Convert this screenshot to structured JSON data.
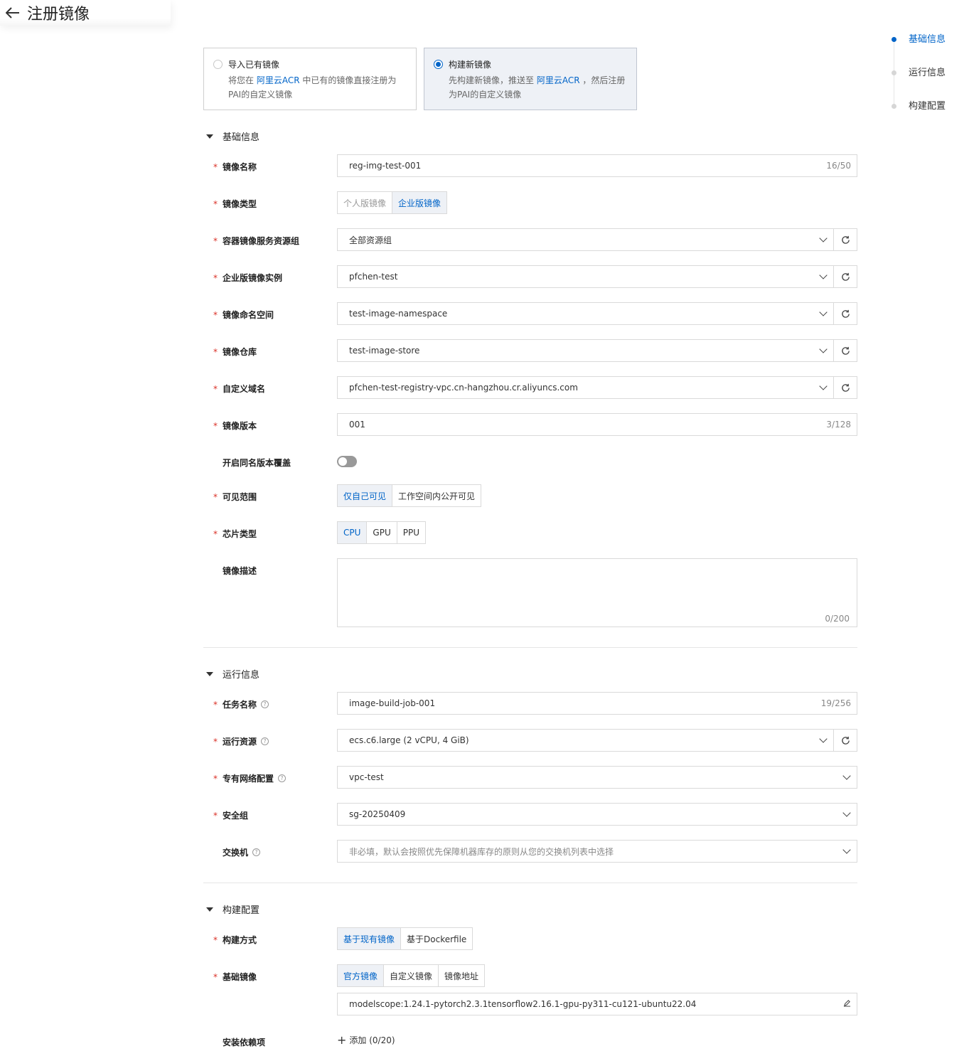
{
  "header": {
    "title": "注册镜像"
  },
  "anchor": [
    "基础信息",
    "运行信息",
    "构建配置"
  ],
  "cards": [
    {
      "title": "导入已有镜像",
      "desc_pre": "将您在 ",
      "desc_link": "阿里云ACR",
      "desc_post": " 中已有的镜像直接注册为PAI的自定义镜像"
    },
    {
      "title": "构建新镜像",
      "desc_pre": "先构建新镜像，推送至 ",
      "desc_link": "阿里云ACR",
      "desc_post": " ，然后注册为PAI的自定义镜像"
    }
  ],
  "basic": {
    "section": "基础信息",
    "name": {
      "label": "镜像名称",
      "value": "reg-img-test-001",
      "count": "16/50"
    },
    "type": {
      "label": "镜像类型",
      "options": [
        "个人版镜像",
        "企业版镜像"
      ]
    },
    "group": {
      "label": "容器镜像服务资源组",
      "value": "全部资源组"
    },
    "instance": {
      "label": "企业版镜像实例",
      "value": "pfchen-test"
    },
    "namespace": {
      "label": "镜像命名空间",
      "value": "test-image-namespace"
    },
    "repo": {
      "label": "镜像仓库",
      "value": "test-image-store"
    },
    "domain": {
      "label": "自定义域名",
      "value": "pfchen-test-registry-vpc.cn-hangzhou.cr.aliyuncs.com"
    },
    "version": {
      "label": "镜像版本",
      "value": "001",
      "count": "3/128"
    },
    "overwrite": {
      "label": "开启同名版本覆盖"
    },
    "visibility": {
      "label": "可见范围",
      "options": [
        "仅自己可见",
        "工作空间内公开可见"
      ]
    },
    "chip": {
      "label": "芯片类型",
      "options": [
        "CPU",
        "GPU",
        "PPU"
      ]
    },
    "desc": {
      "label": "镜像描述",
      "count": "0/200"
    }
  },
  "run": {
    "section": "运行信息",
    "job": {
      "label": "任务名称",
      "value": "image-build-job-001",
      "count": "19/256"
    },
    "resource": {
      "label": "运行资源",
      "value": "ecs.c6.large (2 vCPU, 4 GiB)"
    },
    "vpc": {
      "label": "专有网络配置",
      "value": "vpc-test"
    },
    "sg": {
      "label": "安全组",
      "value": "sg-20250409"
    },
    "vswitch": {
      "label": "交换机",
      "placeholder": "非必填，默认会按照优先保障机器库存的原则从您的交换机列表中选择"
    }
  },
  "build": {
    "section": "构建配置",
    "method": {
      "label": "构建方式",
      "options": [
        "基于现有镜像",
        "基于Dockerfile"
      ]
    },
    "base": {
      "label": "基础镜像",
      "options": [
        "官方镜像",
        "自定义镜像",
        "镜像地址"
      ],
      "value": "modelscope:1.24.1-pytorch2.3.1tensorflow2.16.1-gpu-py311-cu121-ubuntu22.04"
    },
    "deps": {
      "label": "安装依赖项",
      "add": "添加 (0/20)"
    }
  },
  "colors": {
    "accent": "#0064c8",
    "required": "#d93026"
  }
}
